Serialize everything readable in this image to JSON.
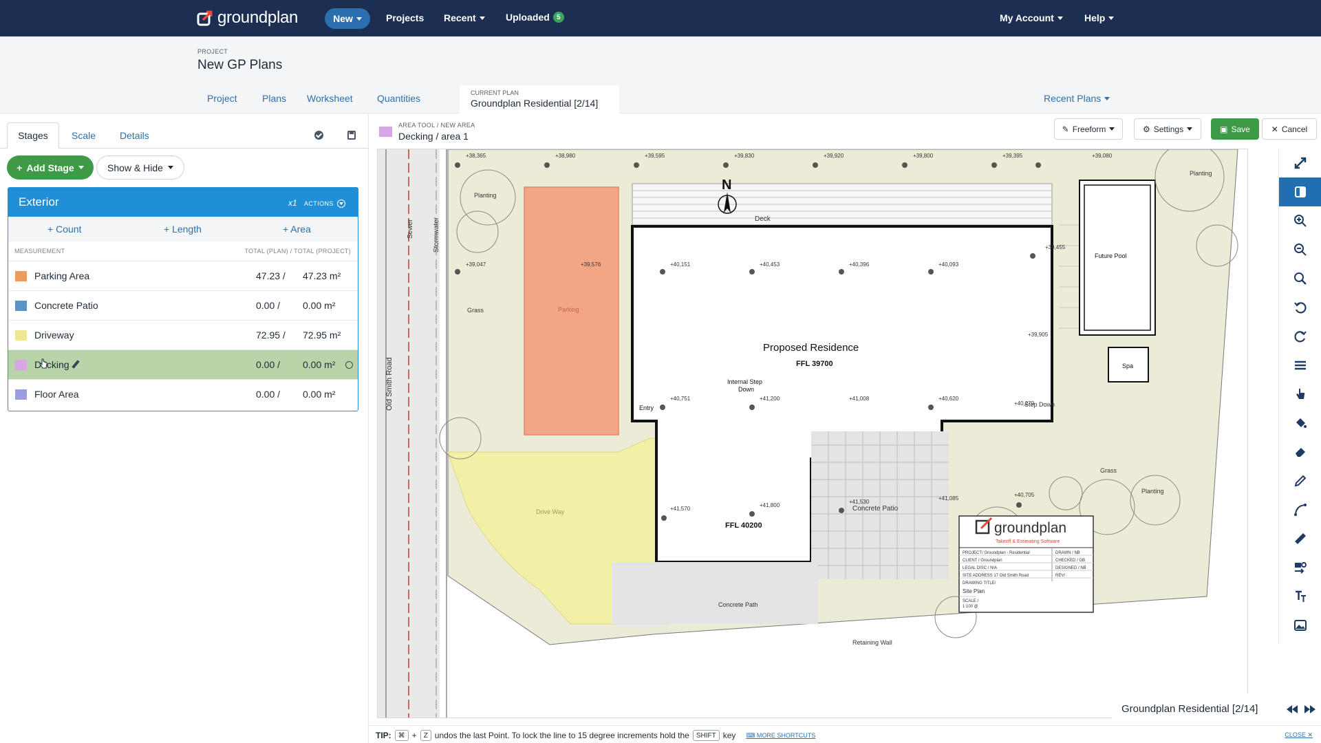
{
  "nav": {
    "logo": "groundplan",
    "new_label": "New",
    "projects_label": "Projects",
    "recent_label": "Recent",
    "uploaded_label": "Uploaded",
    "uploaded_count": "5",
    "account_label": "My Account",
    "help_label": "Help"
  },
  "project": {
    "label": "PROJECT",
    "title": "New GP Plans",
    "tabs": [
      "Project",
      "Plans",
      "Worksheet",
      "Quantities"
    ],
    "current_plan_label": "CURRENT PLAN",
    "current_plan": "Groundplan Residential [2/14]",
    "recent_plans_label": "Recent Plans"
  },
  "panel": {
    "tabs": [
      "Stages",
      "Scale",
      "Details"
    ],
    "add_stage_label": "Add Stage",
    "show_hide_label": "Show & Hide",
    "stage": {
      "name": "Exterior",
      "multiplier": "x1",
      "actions_label": "ACTIONS",
      "add_count": "Count",
      "add_length": "Length",
      "add_area": "Area",
      "col_measurement": "MEASUREMENT",
      "col_totals": "TOTAL (PLAN) / TOTAL (PROJECT)",
      "measurements": [
        {
          "name": "Parking Area",
          "plan": "47.23 /",
          "project": "47.23 m²",
          "color": "#ee9a5f"
        },
        {
          "name": "Concrete Patio",
          "plan": "0.00 /",
          "project": "0.00 m²",
          "color": "#5b93c4"
        },
        {
          "name": "Driveway",
          "plan": "72.95 /",
          "project": "72.95 m²",
          "color": "#f0e592"
        },
        {
          "name": "Decking",
          "plan": "0.00 /",
          "project": "0.00 m²",
          "color": "#d7a6e6"
        },
        {
          "name": "Floor Area",
          "plan": "0.00 /",
          "project": "0.00 m²",
          "color": "#9b9fe0"
        }
      ]
    }
  },
  "toolbar": {
    "crumb": "AREA TOOL / NEW AREA",
    "title": "Decking / area 1",
    "area_color": "#d7a6e6",
    "freeform_label": "Freeform",
    "settings_label": "Settings",
    "save_label": "Save",
    "cancel_label": "Cancel"
  },
  "plan": {
    "north": "N",
    "labels": {
      "residence": "Proposed Residence",
      "ffl1": "FFL 39700",
      "ffl2": "FFL 40200",
      "deck": "Deck",
      "future_pool": "Future Pool",
      "spa": "Spa",
      "planting": "Planting",
      "grass": "Grass",
      "parking": "Parking",
      "driveway": "Drive Way",
      "entry": "Entry",
      "concrete_patio": "Concrete Patio",
      "concrete_path": "Concrete Path",
      "step_down": "Step Down",
      "internal_step": "Internal Step",
      "internal_step2": "Down",
      "retaining_wall": "Retaining Wall",
      "road": "Old Smith Road",
      "sewer": "Sewer",
      "stormwater": "Stormwater"
    },
    "levels_top": [
      "+38,365",
      "+38,980",
      "+39,595",
      "+39,830",
      "+39,920",
      "+39,800",
      "+39,395",
      "+39,080"
    ],
    "levels_mid": [
      "+39,047",
      "+39,576",
      "+40,151",
      "+40,453",
      "+40,396",
      "+40,093",
      "+39,455",
      "+39,905"
    ],
    "levels_low": [
      "+40,751",
      "+41,200",
      "+41,008",
      "+40,620",
      "+40,279",
      "+41,570",
      "+41,800",
      "+41,530",
      "+41,085",
      "+40,705"
    ],
    "title_block": {
      "logo": "groundplan",
      "tagline": "Takeoff & Estimating Software",
      "rows": [
        "PROJECT/ Groundplan - Residential",
        "CLIENT / Groundplan",
        "LEGAL DISC / N/A",
        "SITE ADDRESS 17 Old Smith Road",
        "DRAWING TITLE/",
        "Site Plan"
      ],
      "right_rows": [
        "DRAWN / NB",
        "CHECKED / GB",
        "DESIGNED / NB",
        "REV/"
      ],
      "scale": "SCALE /",
      "scale_val": "1:100 @"
    }
  },
  "plan_nav": {
    "name": "Groundplan Residential [2/14]"
  },
  "tip": {
    "prefix": "TIP:",
    "key1": "⌘",
    "plus": "+",
    "key2": "Z",
    "text1": "undos the last Point. To lock the line to 15 degree increments hold the",
    "key3": "SHIFT",
    "text2": "key",
    "more": "MORE SHORTCUTS",
    "close": "CLOSE"
  }
}
